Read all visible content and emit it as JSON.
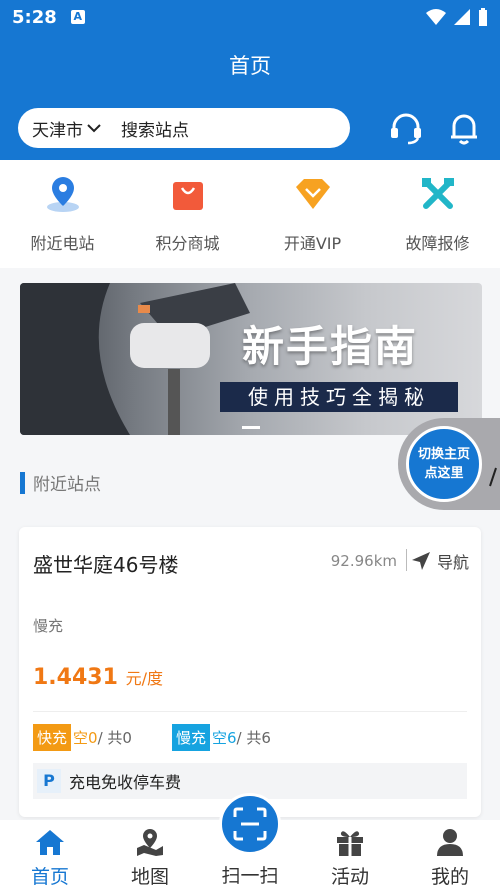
{
  "status_bar": {
    "time": "5:28",
    "a_icon": "A"
  },
  "header": {
    "title": "首页",
    "city": "天津市",
    "search_placeholder": "搜索站点",
    "service_icon": "headset-icon",
    "notify_icon": "bell-icon"
  },
  "menu": [
    {
      "label": "附近电站",
      "icon": "location-pin-icon"
    },
    {
      "label": "积分商城",
      "icon": "shopping-bag-icon"
    },
    {
      "label": "开通VIP",
      "icon": "diamond-icon"
    },
    {
      "label": "故障报修",
      "icon": "tools-icon"
    }
  ],
  "banner": {
    "title": "新手指南",
    "subtitle": "使用技巧全揭秘"
  },
  "float_button": {
    "line1": "切换主页",
    "line2": "点这里"
  },
  "section": {
    "title": "附近站点"
  },
  "station": {
    "name": "盛世华庭46号楼",
    "distance": "92.96km",
    "nav_label": "导航",
    "type": "慢充",
    "price": "1.4431",
    "price_unit": "元/度",
    "fast_tag": "快充",
    "fast_free": "空0",
    "fast_total": "/ 共0",
    "slow_tag": "慢充",
    "slow_free": "空6",
    "slow_total": "/ 共6",
    "parking_badge": "P",
    "parking": "充电免收停车费"
  },
  "tabbar": [
    {
      "label": "首页",
      "icon": "home-icon",
      "active": true
    },
    {
      "label": "地图",
      "icon": "map-icon",
      "active": false
    },
    {
      "label": "扫一扫",
      "icon": "scan-icon",
      "active": false
    },
    {
      "label": "活动",
      "icon": "gift-icon",
      "active": false
    },
    {
      "label": "我的",
      "icon": "user-icon",
      "active": false
    }
  ],
  "colors": {
    "primary": "#1677d2",
    "price": "#f07814",
    "fast": "#f39a14",
    "slow": "#16a3e0"
  }
}
